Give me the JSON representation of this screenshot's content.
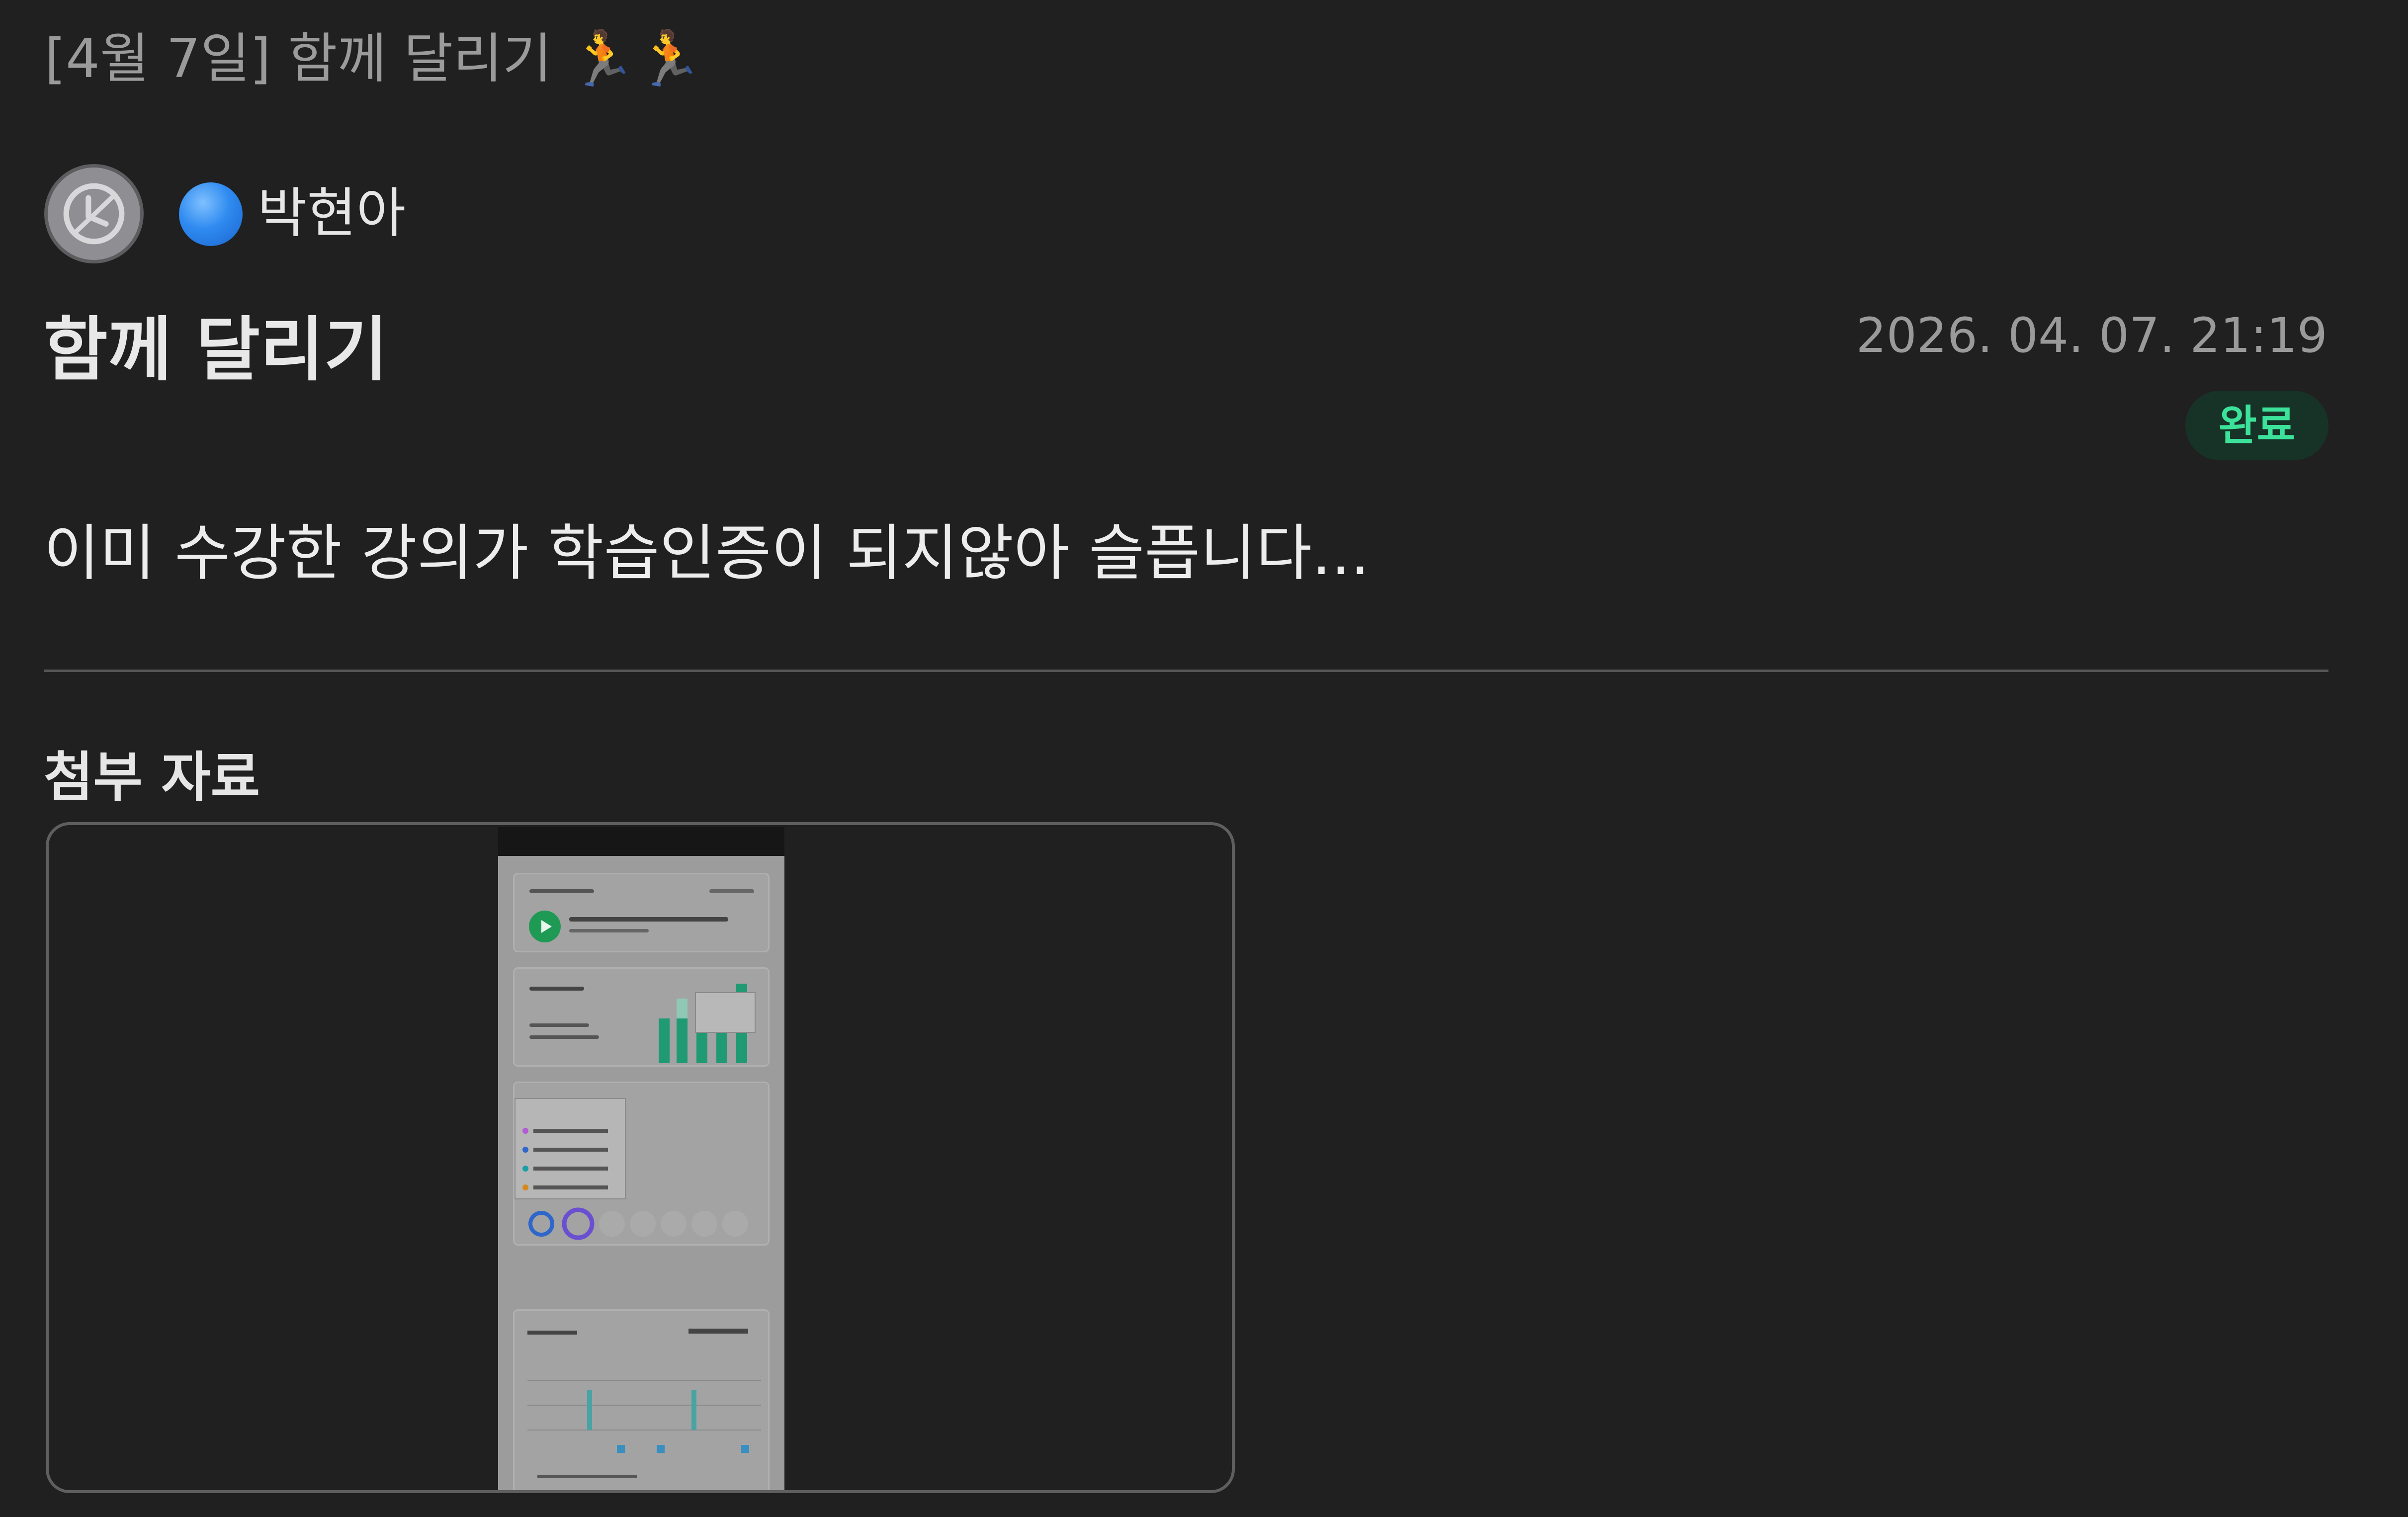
{
  "breadcrumb": "[4월 7일] 함께 달리기 🏃🏃",
  "author": {
    "name": "박현아"
  },
  "post": {
    "title": "함께 달리기",
    "timestamp": "2026. 04. 07. 21:19",
    "status": "완료",
    "body": "이미 수강한 강의가 학습인증이 되지않아 슬픕니다..."
  },
  "attachments": {
    "heading": "첨부 자료"
  },
  "colors": {
    "background": "#202020",
    "status_text": "#3ce29a",
    "status_bg": "#173328",
    "status_dot": "#2f8bf0"
  }
}
